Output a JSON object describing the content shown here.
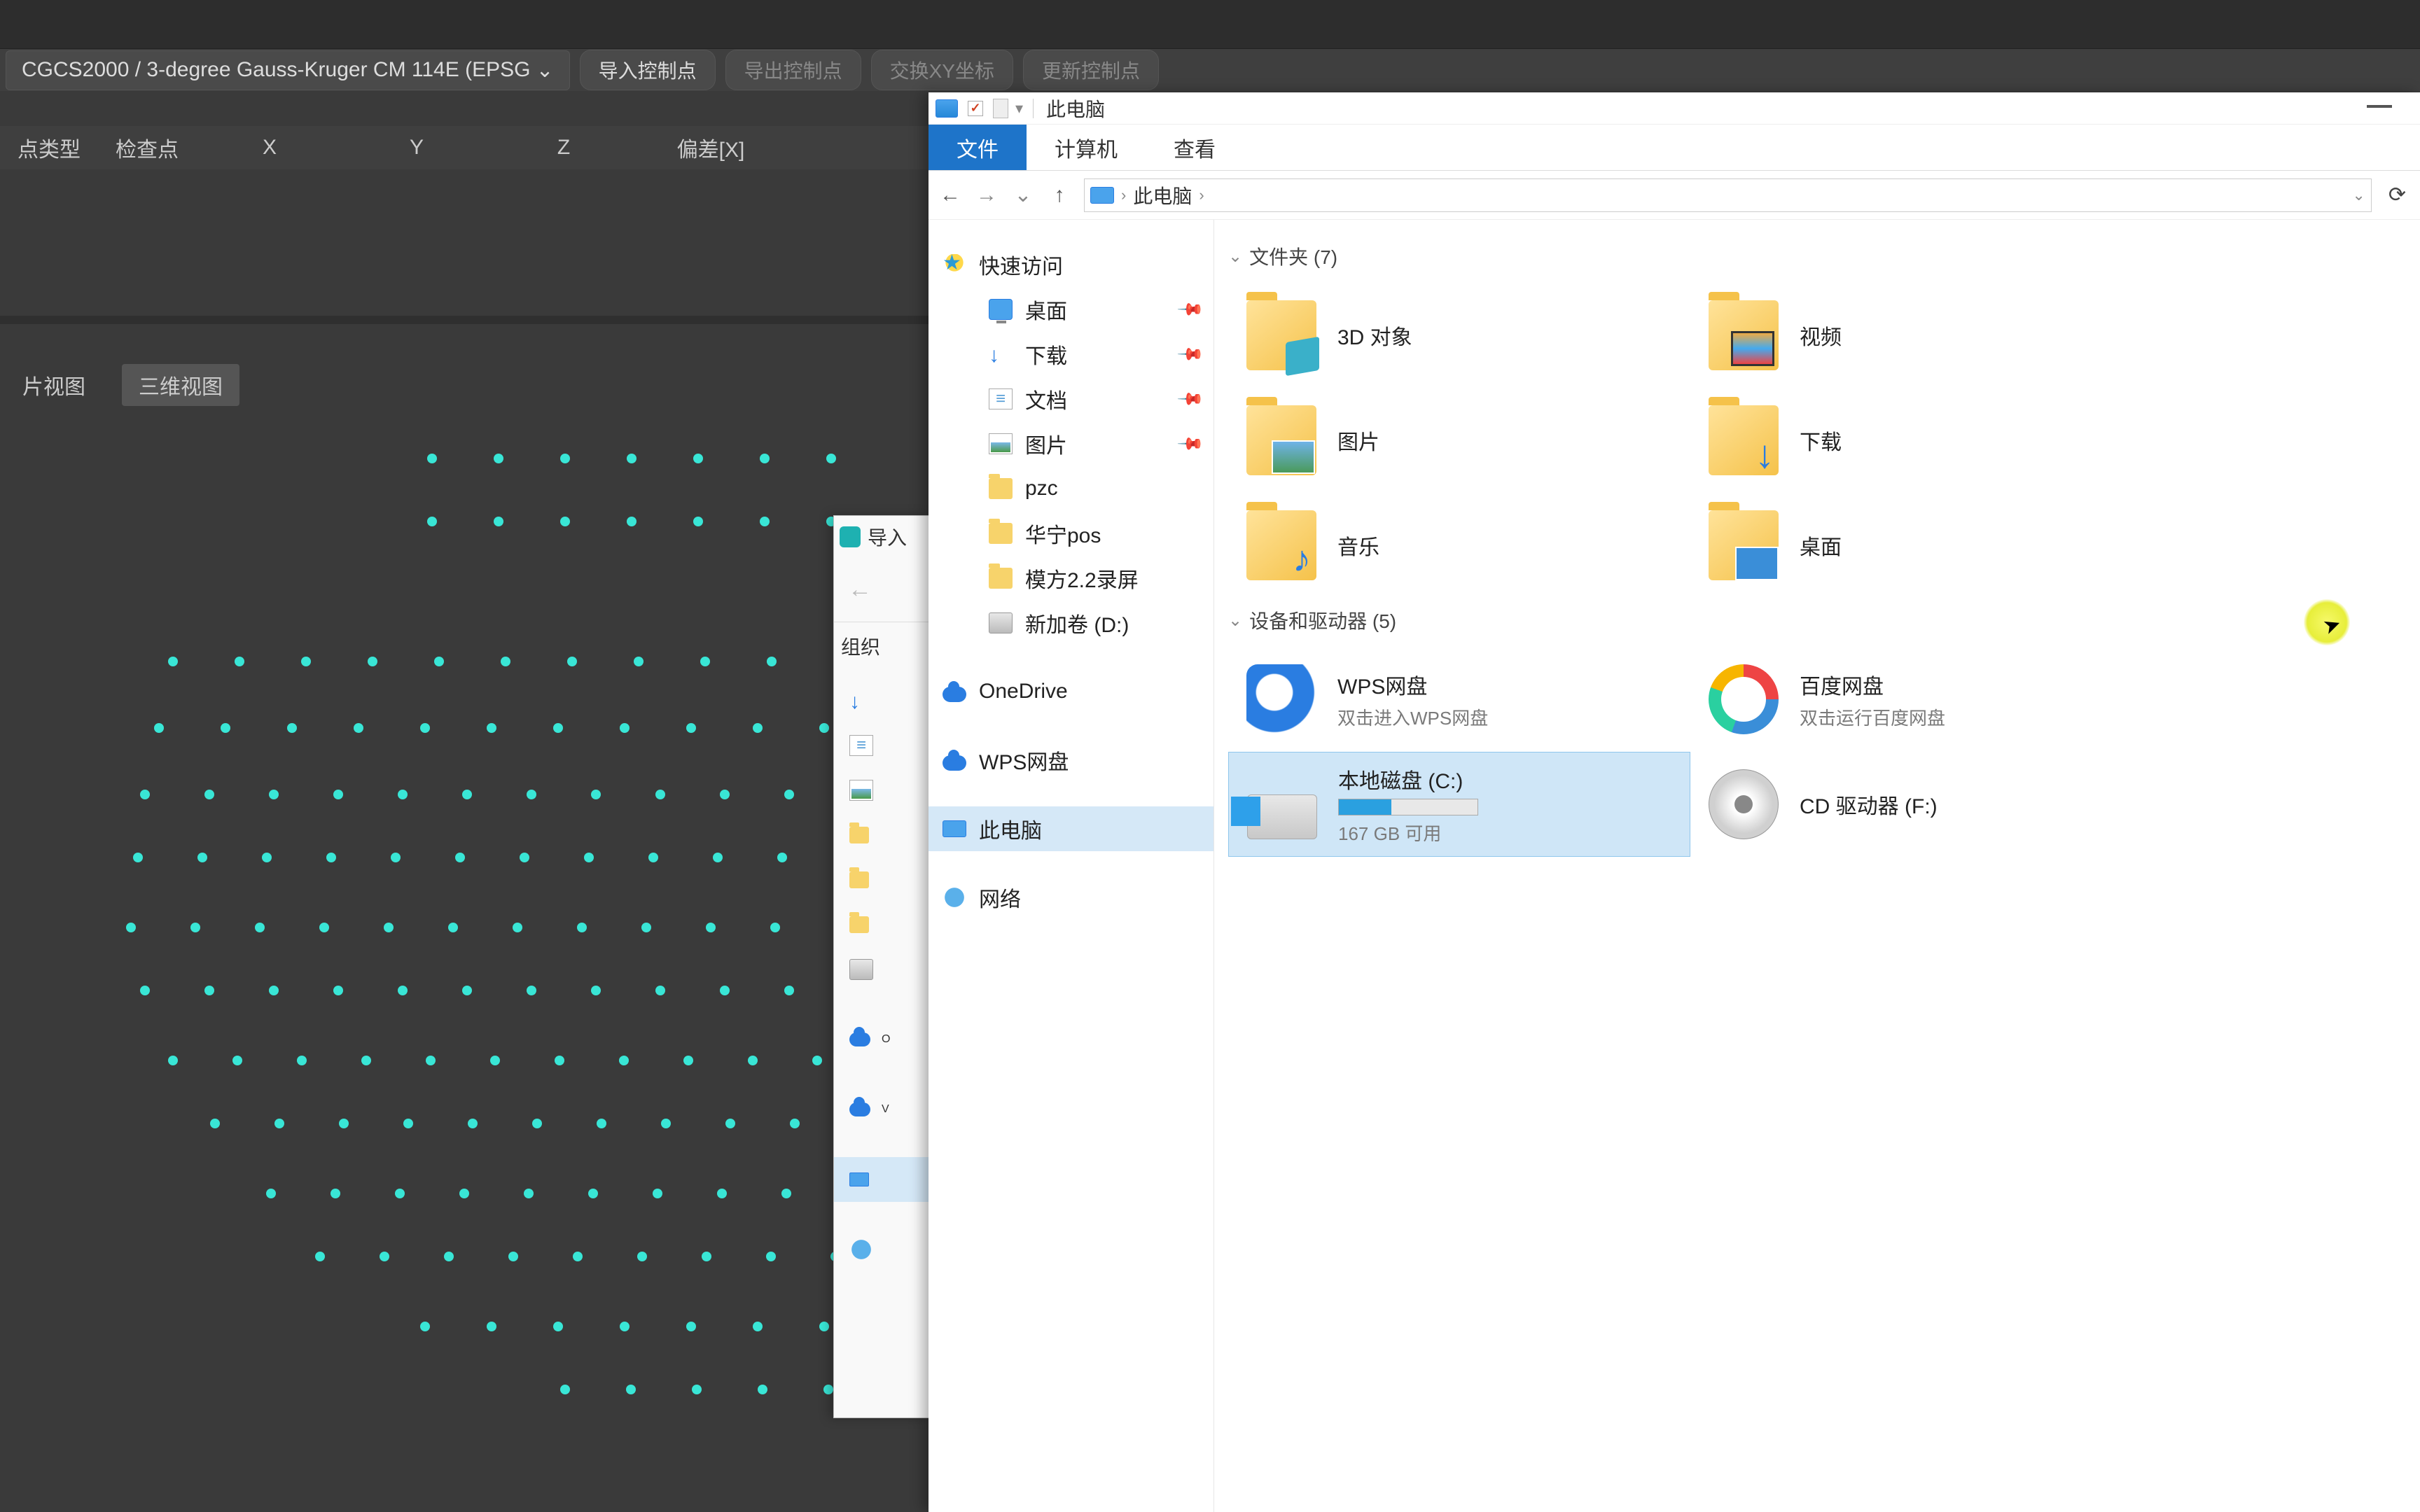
{
  "bg_app": {
    "crs": "CGCS2000 / 3-degree Gauss-Kruger CM 114E (EPSG",
    "toolbar": {
      "import": "导入控制点",
      "export": "导出控制点",
      "swap": "交换XY坐标",
      "update": "更新控制点"
    },
    "columns": {
      "type": "点类型",
      "check": "检查点",
      "x": "X",
      "y": "Y",
      "z": "Z",
      "dev": "偏差[X]"
    },
    "tabs": {
      "img": "片视图",
      "three": "三维视图"
    }
  },
  "mid_dialog": {
    "title": "导入",
    "organize": "组织"
  },
  "explorer": {
    "title": "此电脑",
    "ribbon": {
      "file": "文件",
      "computer": "计算机",
      "view": "查看"
    },
    "breadcrumb": "此电脑",
    "nav": {
      "quick": "快速访问",
      "desktop": "桌面",
      "downloads": "下载",
      "documents": "文档",
      "pictures": "图片",
      "f1": "pzc",
      "f2": "华宁pos",
      "f3": "模方2.2录屏",
      "f4": "新加卷 (D:)",
      "onedrive": "OneDrive",
      "wps": "WPS网盘",
      "thispc": "此电脑",
      "network": "网络"
    },
    "sections": {
      "folders": "文件夹 (7)",
      "devices": "设备和驱动器 (5)"
    },
    "items": {
      "obj3d": "3D 对象",
      "video": "视频",
      "pic": "图片",
      "dl": "下载",
      "music": "音乐",
      "desk": "桌面",
      "wps_name": "WPS网盘",
      "wps_sub": "双击进入WPS网盘",
      "baidu_name": "百度网盘",
      "baidu_sub": "双击运行百度网盘",
      "cdisk_name": "本地磁盘 (C:)",
      "cdisk_sub": "167 GB 可用",
      "cd_name": "CD 驱动器 (F:)"
    }
  }
}
